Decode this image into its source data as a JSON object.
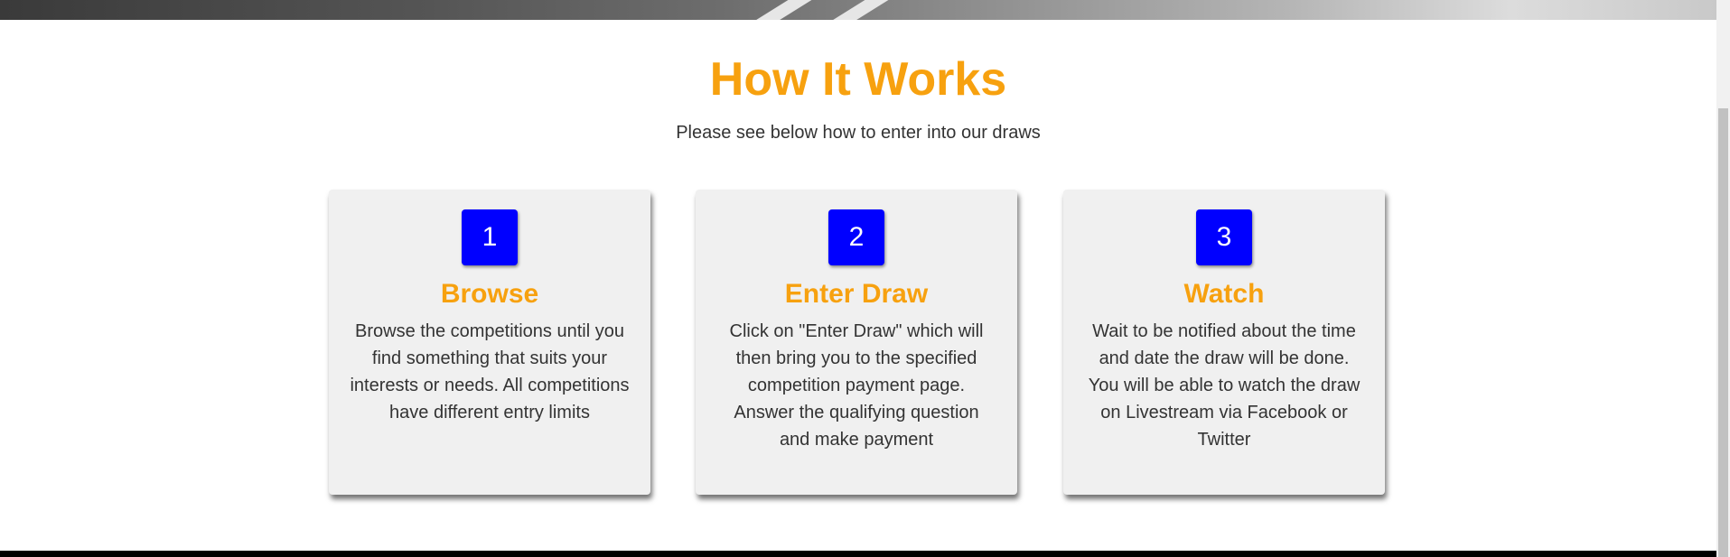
{
  "section": {
    "title": "How It Works",
    "subtitle": "Please see below how to enter into our draws"
  },
  "steps": [
    {
      "number": "1",
      "title": "Browse",
      "text": "Browse the competitions until you find something that suits your interests or needs. All competitions have different entry limits"
    },
    {
      "number": "2",
      "title": "Enter Draw",
      "text": "Click on \"Enter Draw\" which will then bring you to the specified competition payment page. Answer the qualifying question and make payment"
    },
    {
      "number": "3",
      "title": "Watch",
      "text": "Wait to be notified about the time and date the draw will be done. You will be able to watch the draw on Livestream via Facebook or Twitter"
    }
  ],
  "colors": {
    "accent": "#f7a10f",
    "badge": "#0000ff",
    "card_bg": "#f0f0f0",
    "text": "#333333"
  }
}
